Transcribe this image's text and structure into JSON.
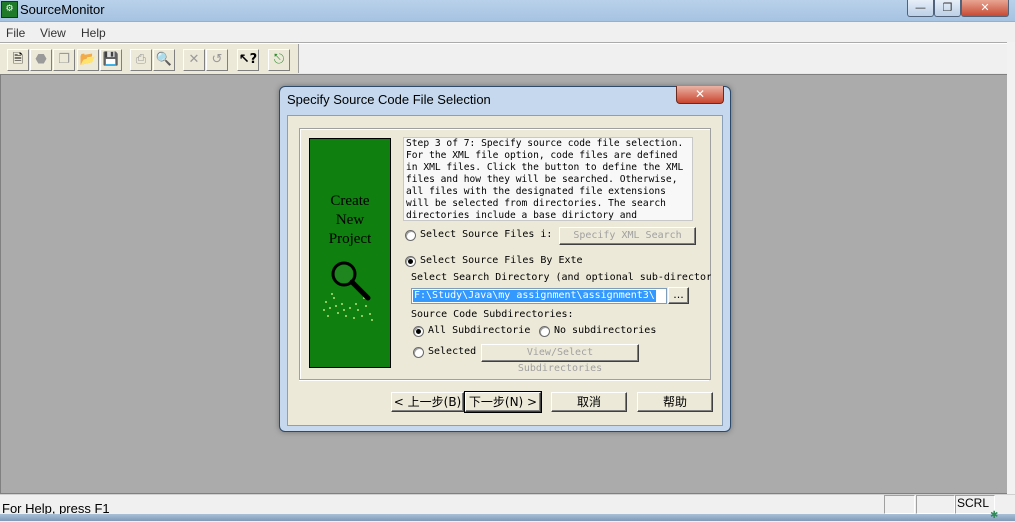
{
  "window": {
    "title": "SourceMonitor",
    "app_icon_glyph": "⚙"
  },
  "menu": [
    "File",
    "View",
    "Help"
  ],
  "toolbar": {
    "icons": [
      "new-file-icon",
      "stop-icon",
      "copy-icon",
      "open-folder-icon",
      "save-icon",
      "print-icon",
      "print-preview-icon",
      "close-x-icon",
      "undo-icon",
      "help-pointer-icon",
      "exit-icon"
    ]
  },
  "dialog": {
    "title": "Specify Source Code File Selection",
    "panel_lines": [
      "Create",
      "New",
      "Project"
    ],
    "step_text": "Step 3 of 7: Specify source code file selection. For the XML file option, code files are defined in XML files. Click the button to define the XML files and how they will be searched. Otherwise, all files with the designated file extensions will be selected from directories. The search directories include a base dirictory and",
    "opt_xml_label": "Select Source Files i:",
    "xml_button": "Specify XML Search",
    "opt_ext_label": "Select Source Files By Exte",
    "search_dir_label": "Select Search Directory (and optional sub-director",
    "dir_value": "F:\\Study\\Java\\my assignment\\assignment3\\",
    "browse_button": "...",
    "subdirs_label": "Source Code Subdirectories:",
    "all_subdirs": "All Subdirectorie",
    "no_subdirs": "No subdirectories",
    "selected": "Selected",
    "view_select_button": "View/Select Subdirectories",
    "buttons": {
      "back": "< 上一步(B)",
      "next": "下一步(N) >",
      "cancel": "取消",
      "help": "帮助"
    }
  },
  "status": {
    "text": "For Help, press F1",
    "scrl": "SCRL"
  }
}
